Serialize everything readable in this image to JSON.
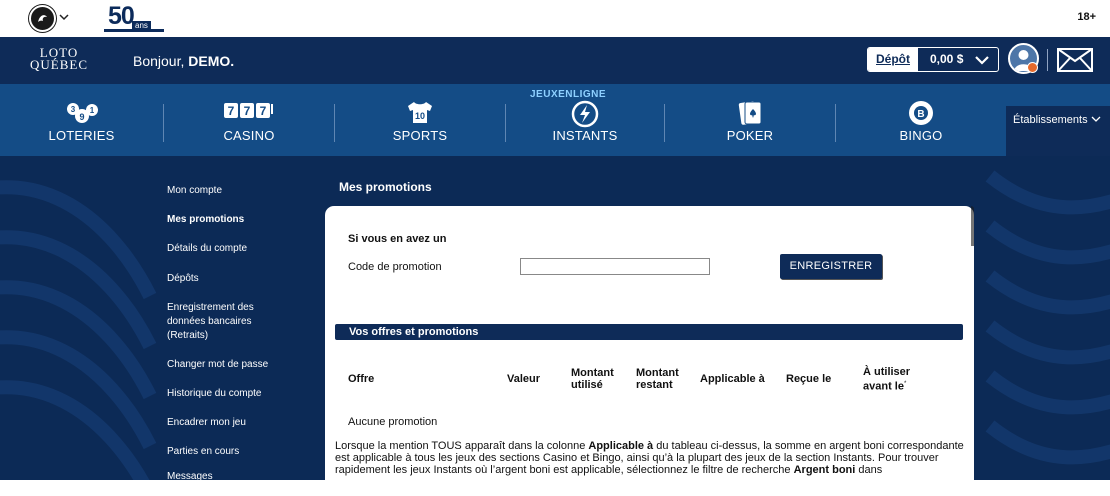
{
  "topbar": {
    "anniversary_number": "50",
    "anniversary_suffix": "ans",
    "age_limit": "18+"
  },
  "header": {
    "logo_line1": "LOTO",
    "logo_line2": "QUÉBEC",
    "greeting": "Bonjour,",
    "username": "DEMO.",
    "deposit_label": "Dépôt",
    "balance": "0,00 $"
  },
  "nav": {
    "jeux_en_ligne": "JEUXENLIGNE",
    "items": [
      {
        "label": "LOTERIES",
        "icon": "lottery-balls-icon"
      },
      {
        "label": "CASINO",
        "icon": "slot-777-icon"
      },
      {
        "label": "SPORTS",
        "icon": "jersey-icon"
      },
      {
        "label": "INSTANTS",
        "icon": "lightning-icon"
      },
      {
        "label": "POKER",
        "icon": "playing-card-icon"
      },
      {
        "label": "BINGO",
        "icon": "bingo-ball-icon"
      }
    ],
    "establishments": "Établissements"
  },
  "sidebar": {
    "items": [
      {
        "label": "Mon compte",
        "active": false
      },
      {
        "label": "Mes promotions",
        "active": true
      },
      {
        "label": "Détails du compte",
        "active": false
      },
      {
        "label": "Dépôts",
        "active": false
      },
      {
        "label": "Enregistrement des",
        "active": false
      },
      {
        "label": "données bancaires",
        "active": false
      },
      {
        "label": "(Retraits)",
        "active": false
      },
      {
        "label": "Changer mot de passe",
        "active": false
      },
      {
        "label": "Historique du compte",
        "active": false
      },
      {
        "label": "Encadrer mon jeu",
        "active": false
      },
      {
        "label": "Parties en cours",
        "active": false
      },
      {
        "label": "Messages",
        "active": false
      }
    ]
  },
  "main": {
    "title": "Mes promotions",
    "section_title": "Si vous en avez un",
    "promo_code_label": "Code de promotion",
    "promo_code_value": "",
    "register_button": "ENREGISTRER",
    "offers_title": "Vos offres et promotions",
    "columns": {
      "offre": "Offre",
      "valeur": "Valeur",
      "montant_utilise_1": "Montant",
      "montant_utilise_2": "utilisé",
      "montant_restant_1": "Montant",
      "montant_restant_2": "restant",
      "applicable": "Applicable à",
      "recue": "Reçue le",
      "utiliser_1": "À utiliser",
      "utiliser_2": "avant le",
      "utiliser_mark": "*"
    },
    "no_promotion": "Aucune promotion",
    "note_part1": "Lorsque la mention TOUS apparaît dans la colonne ",
    "note_bold1": "Applicable à",
    "note_part2": " du tableau ci-dessus, la somme en argent boni correspondante est applicable à tous les jeux des sections Casino et Bingo, ainsi qu’à la plupart des jeux de la section Instants. Pour trouver rapidement les jeux Instants où l’argent boni est applicable, sélectionnez le filtre de recherche ",
    "note_bold2": "Argent boni",
    "note_part3": " dans"
  },
  "colors": {
    "header_navy": "#0e2b58",
    "nav_blue": "#144c86",
    "background_navy": "#0c2a56",
    "accent_light_blue": "#8ed0ff",
    "notification_orange": "#e66a2c"
  }
}
